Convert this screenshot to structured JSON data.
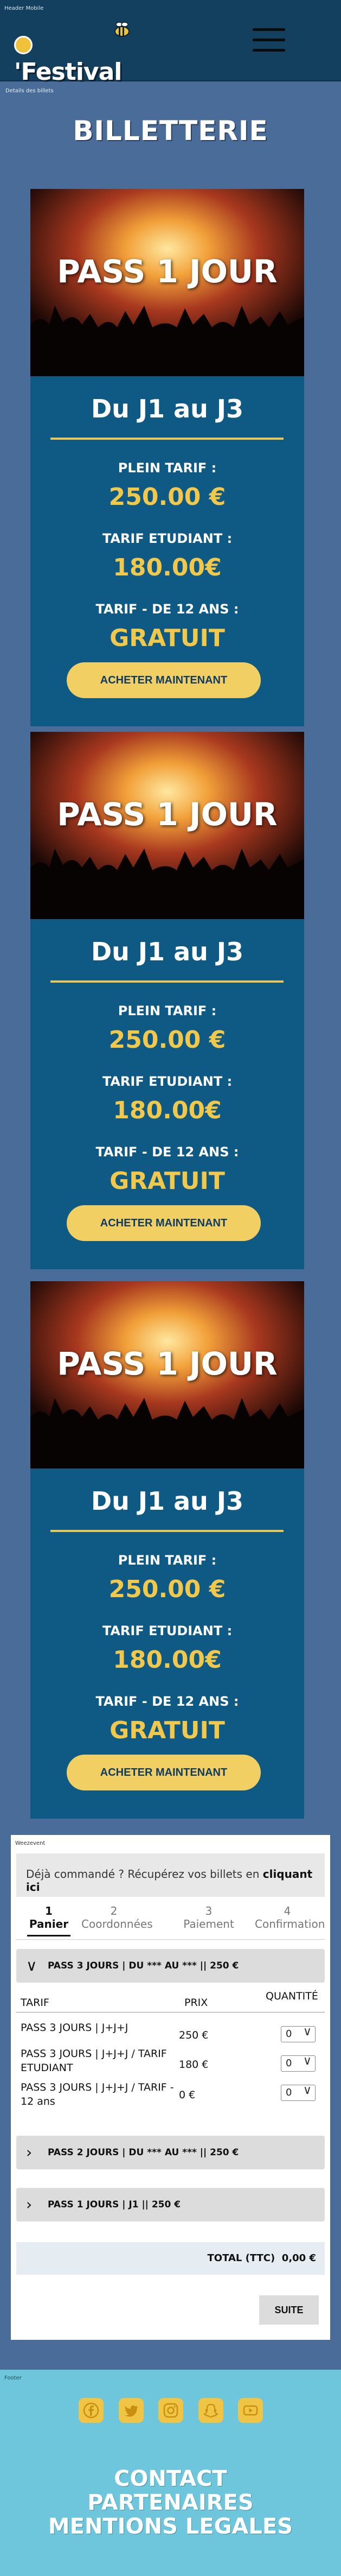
{
  "header": {
    "frame_label": "Header Mobile",
    "logo_text": "Festival",
    "logo_apostrophe": "'"
  },
  "main": {
    "frame_label": "Details des billets",
    "title": "BILLETTERIE"
  },
  "cards": [
    {
      "image_label": "PASS 1 JOUR",
      "subtitle": "Du J1 au J3",
      "prices": [
        {
          "label": "PLEIN TARIF :",
          "value": "250.00 €"
        },
        {
          "label": "TARIF ETUDIANT :",
          "value": "180.00€"
        },
        {
          "label": "TARIF - DE 12 ANS :",
          "value": "GRATUIT"
        }
      ],
      "button": "ACHETER MAINTENANT"
    },
    {
      "image_label": "PASS 1 JOUR",
      "subtitle": "Du J1 au J3",
      "prices": [
        {
          "label": "PLEIN TARIF :",
          "value": "250.00 €"
        },
        {
          "label": "TARIF ETUDIANT :",
          "value": "180.00€"
        },
        {
          "label": "TARIF - DE 12 ANS :",
          "value": "GRATUIT"
        }
      ],
      "button": "ACHETER MAINTENANT"
    },
    {
      "image_label": "PASS 1 JOUR",
      "subtitle": "Du J1 au J3",
      "prices": [
        {
          "label": "PLEIN TARIF :",
          "value": "250.00 €"
        },
        {
          "label": "TARIF ETUDIANT :",
          "value": "180.00€"
        },
        {
          "label": "TARIF - DE 12 ANS :",
          "value": "GRATUIT"
        }
      ],
      "button": "ACHETER MAINTENANT"
    }
  ],
  "order": {
    "frame_label": "Weezevent",
    "notice_text": "Déjà commandé ? Récupérez vos billets en ",
    "notice_link": "cliquant ici",
    "steps": [
      {
        "num": "1",
        "label": "Panier"
      },
      {
        "num": "2",
        "label": "Coordonnées"
      },
      {
        "num": "3",
        "label": "Paiement"
      },
      {
        "num": "4",
        "label": "Confirmation"
      }
    ],
    "accordion_open": "PASS 3 JOURS | DU *** AU *** || 250 €",
    "table_headers": {
      "tarif": "TARIF",
      "prix": "PRIX",
      "quantite": "QUANTITÉ"
    },
    "rows": [
      {
        "name": "PASS 3 JOURS | J+J+J",
        "price": "250 €",
        "qty": "0"
      },
      {
        "name": "PASS 3 JOURS | J+J+J / TARIF ETUDIANT",
        "price": "180 €",
        "qty": "0"
      },
      {
        "name": "PASS 3 JOURS | J+J+J / TARIF - 12 ans",
        "price": "0 €",
        "qty": "0"
      }
    ],
    "accordion_2": "PASS 2 JOURS | DU *** AU *** || 250 €",
    "accordion_3": "PASS 1 JOURS | J1 || 250 €",
    "total_label": "TOTAL (TTC)",
    "total_value": "0,00 €",
    "next_button": "SUITE"
  },
  "footer": {
    "frame_label": "Footer",
    "socials": [
      "facebook-icon",
      "twitter-icon",
      "instagram-icon",
      "snapchat-icon",
      "youtube-icon"
    ],
    "links": [
      "CONTACT",
      "PARTENAIRES",
      "MENTIONS LEGALES"
    ]
  },
  "colors": {
    "background": "#4a6c99",
    "header": "#14405f",
    "card": "#0e5a85",
    "accent": "#f2c84b",
    "footer": "#6ec6dc"
  }
}
